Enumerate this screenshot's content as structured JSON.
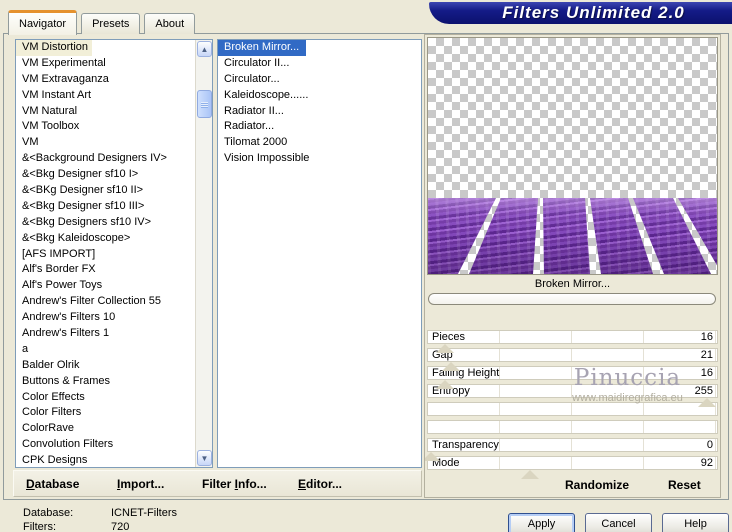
{
  "window": {
    "title": "Filters Unlimited 2.0"
  },
  "tabs": [
    {
      "label": "Navigator"
    },
    {
      "label": "Presets"
    },
    {
      "label": "About"
    }
  ],
  "categories": {
    "selected_index": 0,
    "items": [
      "VM Distortion",
      "VM Experimental",
      "VM Extravaganza",
      "VM Instant Art",
      "VM Natural",
      "VM Toolbox",
      "VM",
      "&<Background Designers IV>",
      "&<Bkg Designer sf10 I>",
      "&<BKg Designer sf10 II>",
      "&<Bkg Designer sf10 III>",
      "&<Bkg Designers sf10 IV>",
      "&<Bkg Kaleidoscope>",
      "[AFS IMPORT]",
      "Alf's Border FX",
      "Alf's Power Toys",
      "Andrew's Filter Collection 55",
      "Andrew's Filters 10",
      "Andrew's Filters 1",
      "a",
      "Balder Olrik",
      "Buttons & Frames",
      "Color Effects",
      "Color Filters",
      "ColorRave",
      "Convolution Filters",
      "CPK Designs"
    ]
  },
  "filters": {
    "selected_index": 0,
    "items": [
      "Broken Mirror...",
      "Circulator II...",
      "Circulator...",
      "Kaleidoscope......",
      "Radiator II...",
      "Radiator...",
      "Tilomat 2000",
      "Vision Impossible"
    ]
  },
  "preview": {
    "label": "Broken Mirror...",
    "progress_value": ""
  },
  "sliders": [
    {
      "label": "Pieces",
      "value": "16"
    },
    {
      "label": "Gap",
      "value": "21"
    },
    {
      "label": "Falling Height",
      "value": "16"
    },
    {
      "label": "Entropy",
      "value": "255"
    },
    {
      "label": "",
      "value": ""
    },
    {
      "label": "",
      "value": ""
    },
    {
      "label": "Transparency",
      "value": "0"
    },
    {
      "label": "Mode",
      "value": "92"
    }
  ],
  "panel_buttons": {
    "randomize": "Randomize",
    "reset": "Reset"
  },
  "toolbar": {
    "items": [
      {
        "pre": "",
        "key": "D",
        "post": "atabase"
      },
      {
        "pre": "",
        "key": "I",
        "post": "mport..."
      },
      {
        "pre": "Filter ",
        "key": "I",
        "post": "nfo..."
      },
      {
        "pre": "",
        "key": "E",
        "post": "ditor..."
      }
    ]
  },
  "status": {
    "database_label": "Database:",
    "database_value": "ICNET-Filters",
    "filters_label": "Filters:",
    "filters_value": "720"
  },
  "actions": {
    "apply": "Apply",
    "cancel": "Cancel",
    "help": "Help"
  },
  "watermark": {
    "name": "Pinuccia",
    "url": "www.maidiregrafica.eu"
  },
  "colors": {
    "banner": "#121a86",
    "tab_accent": "#e5912d",
    "selection_blue": "#316ac5",
    "selection_cream": "#f2efd8",
    "dialog_bg": "#ece9d8",
    "mirror_purple": "#7a3fae"
  }
}
